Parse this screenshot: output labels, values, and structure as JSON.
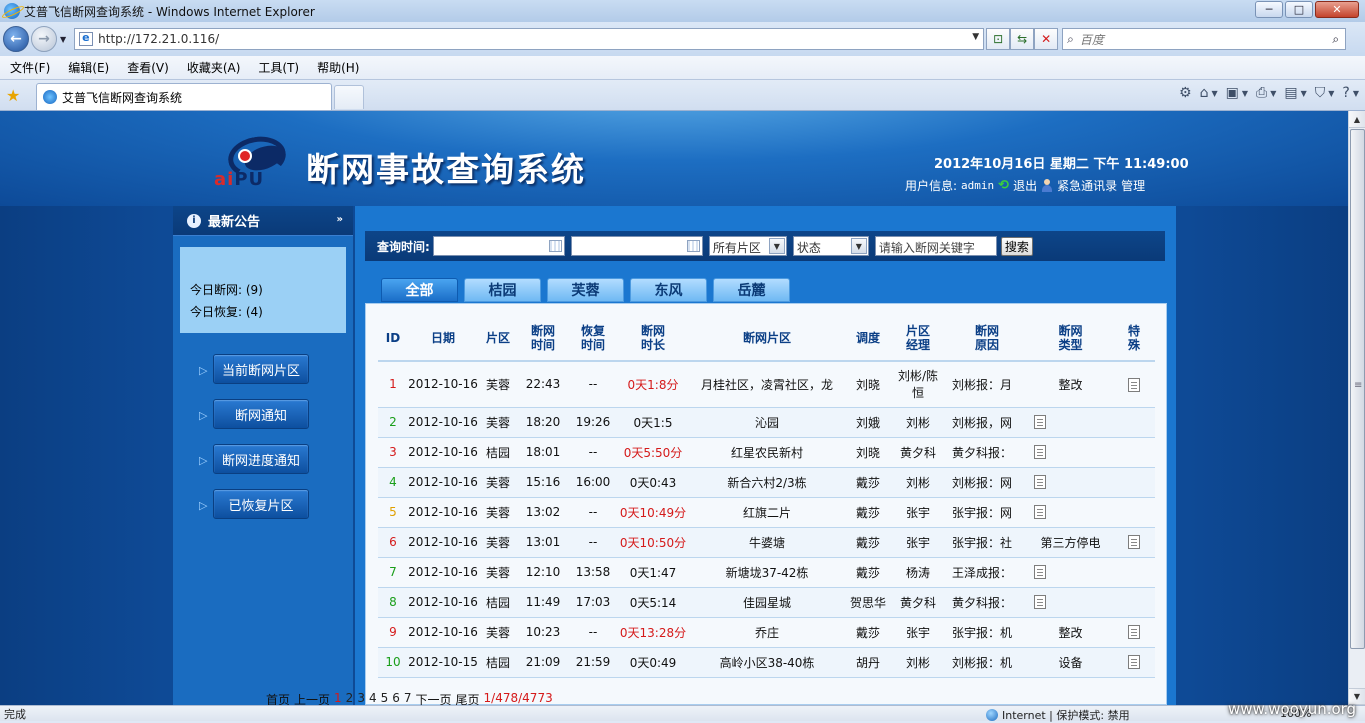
{
  "window": {
    "title": "艾普飞信断网查询系统 - Windows Internet Explorer",
    "buttons": {
      "minimize": "─",
      "maximize": "□",
      "close": "✕"
    }
  },
  "address": {
    "url": "http://172.21.0.116/",
    "search_placeholder": "百度"
  },
  "menu": [
    "文件(F)",
    "编辑(E)",
    "查看(V)",
    "收藏夹(A)",
    "工具(T)",
    "帮助(H)"
  ],
  "tab": {
    "title": "艾普飞信断网查询系统"
  },
  "header": {
    "logo_text_a": "ai",
    "logo_text_b": "PU",
    "site_title": "断网事故查询系统",
    "datetime": "2012年10月16日 星期二 下午 11:49:00",
    "user_label": "用户信息:",
    "user_name": "admin",
    "logout": "退出",
    "contacts": "紧急通讯录",
    "admin": "管理"
  },
  "sidebar": {
    "notice_title": "最新公告",
    "today_down": "今日断网: (9)",
    "today_restored": "今日恢复: (4)",
    "buttons": [
      "当前断网片区",
      "断网通知",
      "断网进度通知",
      "已恢复片区"
    ]
  },
  "query": {
    "label": "查询时间:",
    "area_select": "所有片区",
    "status_select": "状态",
    "keyword_placeholder": "请输入断网关键字",
    "search_button": "搜索"
  },
  "tabs": [
    "全部",
    "桔园",
    "芙蓉",
    "东风",
    "岳麓"
  ],
  "table": {
    "headers": [
      "ID",
      "日期",
      "片区",
      "断网时间",
      "恢复时间",
      "断网时长",
      "断网片区",
      "调度",
      "片区经理",
      "断网原因",
      "断网类型",
      "特殊"
    ],
    "rows": [
      {
        "id": "1",
        "id_color": "red",
        "date": "2012-10-16",
        "area": "芙蓉",
        "down": "22:43",
        "restore": "--",
        "duration": "0天1:8分",
        "dur_red": true,
        "zone": "月桂社区，凌霄社区，龙",
        "dispatcher": "刘晓",
        "manager": "刘彬/陈恒",
        "reason": "刘彬报：月",
        "type": "整改",
        "doc_in_type": false
      },
      {
        "id": "2",
        "id_color": "green",
        "date": "2012-10-16",
        "area": "芙蓉",
        "down": "18:20",
        "restore": "19:26",
        "duration": "0天1:5",
        "dur_red": false,
        "zone": "沁园",
        "dispatcher": "刘娥",
        "manager": "刘彬",
        "reason": "刘彬报，网",
        "type": "",
        "doc_in_type": true
      },
      {
        "id": "3",
        "id_color": "red",
        "date": "2012-10-16",
        "area": "桔园",
        "down": "18:01",
        "restore": "--",
        "duration": "0天5:50分",
        "dur_red": true,
        "zone": "红星农民新村",
        "dispatcher": "刘晓",
        "manager": "黄夕科",
        "reason": "黄夕科报：",
        "type": "",
        "doc_in_type": true
      },
      {
        "id": "4",
        "id_color": "green",
        "date": "2012-10-16",
        "area": "芙蓉",
        "down": "15:16",
        "restore": "16:00",
        "duration": "0天0:43",
        "dur_red": false,
        "zone": "新合六村2/3栋",
        "dispatcher": "戴莎",
        "manager": "刘彬",
        "reason": "刘彬报：网",
        "type": "",
        "doc_in_type": true
      },
      {
        "id": "5",
        "id_color": "orange",
        "date": "2012-10-16",
        "area": "芙蓉",
        "down": "13:02",
        "restore": "--",
        "duration": "0天10:49分",
        "dur_red": true,
        "zone": "红旗二片",
        "dispatcher": "戴莎",
        "manager": "张宇",
        "reason": "张宇报：网",
        "type": "",
        "doc_in_type": true
      },
      {
        "id": "6",
        "id_color": "red",
        "date": "2012-10-16",
        "area": "芙蓉",
        "down": "13:01",
        "restore": "--",
        "duration": "0天10:50分",
        "dur_red": true,
        "zone": "牛婆塘",
        "dispatcher": "戴莎",
        "manager": "张宇",
        "reason": "张宇报：社",
        "type": "第三方停电",
        "doc_in_type": false
      },
      {
        "id": "7",
        "id_color": "green",
        "date": "2012-10-16",
        "area": "芙蓉",
        "down": "12:10",
        "restore": "13:58",
        "duration": "0天1:47",
        "dur_red": false,
        "zone": "新塘垅37-42栋",
        "dispatcher": "戴莎",
        "manager": "杨涛",
        "reason": "王泽成报：",
        "type": "",
        "doc_in_type": true
      },
      {
        "id": "8",
        "id_color": "green",
        "date": "2012-10-16",
        "area": "桔园",
        "down": "11:49",
        "restore": "17:03",
        "duration": "0天5:14",
        "dur_red": false,
        "zone": "佳园星城",
        "dispatcher": "贺思华",
        "manager": "黄夕科",
        "reason": "黄夕科报：",
        "type": "",
        "doc_in_type": true
      },
      {
        "id": "9",
        "id_color": "red",
        "date": "2012-10-16",
        "area": "芙蓉",
        "down": "10:23",
        "restore": "--",
        "duration": "0天13:28分",
        "dur_red": true,
        "zone": "乔庄",
        "dispatcher": "戴莎",
        "manager": "张宇",
        "reason": "张宇报：机",
        "type": "整改",
        "doc_in_type": false
      },
      {
        "id": "10",
        "id_color": "green",
        "date": "2012-10-15",
        "area": "桔园",
        "down": "21:09",
        "restore": "21:59",
        "duration": "0天0:49",
        "dur_red": false,
        "zone": "高岭小区38-40栋",
        "dispatcher": "胡丹",
        "manager": "刘彬",
        "reason": "刘彬报：机",
        "type": "设备",
        "doc_in_type": false
      }
    ]
  },
  "pager": {
    "first": "首页",
    "prev": "上一页",
    "pages": [
      "1",
      "2",
      "3",
      "4",
      "5",
      "6",
      "7"
    ],
    "next": "下一页",
    "last": "尾页",
    "info": "1/478/4773"
  },
  "status": {
    "left": "完成",
    "zone": "Internet | 保护模式: 禁用",
    "zoom": "100%"
  },
  "watermark": "www.wooyun.org",
  "colors": {
    "red": "#d51a1a",
    "green": "#1a9e1a",
    "orange": "#e0a000",
    "header_blue": "#1d6ec2",
    "tab_active": "#1b6ec8"
  }
}
